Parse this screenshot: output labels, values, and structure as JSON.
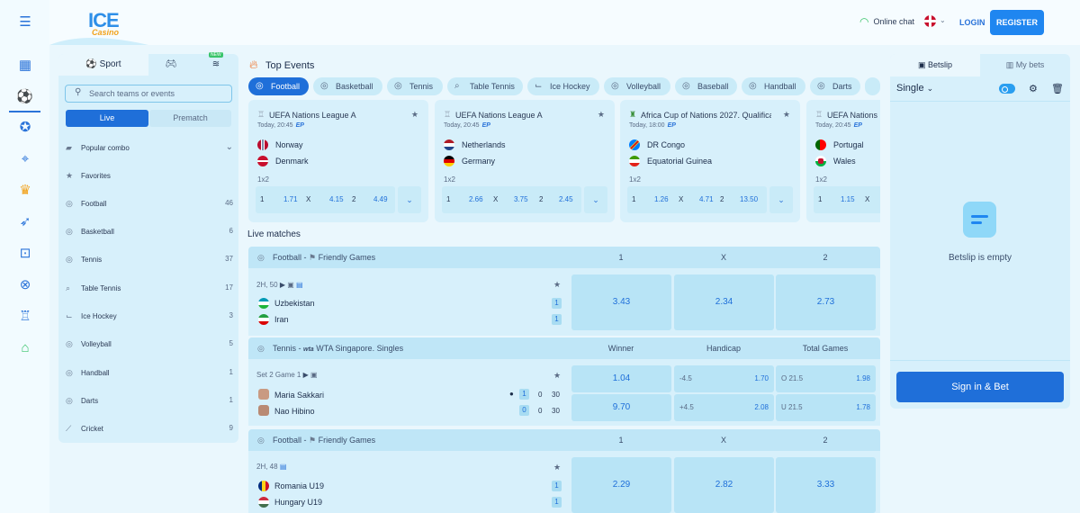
{
  "header": {
    "logo_text": "ICE",
    "logo_sub": "Casino",
    "online_chat": "Online chat",
    "login": "LOGIN",
    "register": "REGISTER"
  },
  "sport_panel": {
    "tabs": [
      "Sport",
      "",
      "",
      ""
    ],
    "new_badge": "NEW",
    "search_placeholder": "Search teams or events",
    "live": "Live",
    "prematch": "Prematch",
    "items": [
      {
        "label": "Popular combo",
        "count": ""
      },
      {
        "label": "Favorites",
        "count": ""
      },
      {
        "label": "Football",
        "count": "46"
      },
      {
        "label": "Basketball",
        "count": "6"
      },
      {
        "label": "Tennis",
        "count": "37"
      },
      {
        "label": "Table Tennis",
        "count": "17"
      },
      {
        "label": "Ice Hockey",
        "count": "3"
      },
      {
        "label": "Volleyball",
        "count": "5"
      },
      {
        "label": "Handball",
        "count": "1"
      },
      {
        "label": "Darts",
        "count": "1"
      },
      {
        "label": "Cricket",
        "count": "9"
      }
    ]
  },
  "top_events": {
    "title": "Top Events",
    "chips": [
      "Football",
      "Basketball",
      "Tennis",
      "Table Tennis",
      "Ice Hockey",
      "Volleyball",
      "Baseball",
      "Handball",
      "Darts"
    ],
    "cards": [
      {
        "league": "UEFA Nations League A",
        "time": "Today, 20:45",
        "ep": "EP",
        "team1": "Norway",
        "team2": "Denmark",
        "market": "1x2",
        "o1": "1.71",
        "ox": "4.15",
        "o2": "4.49"
      },
      {
        "league": "UEFA Nations League A",
        "time": "Today, 20:45",
        "ep": "EP",
        "team1": "Netherlands",
        "team2": "Germany",
        "market": "1x2",
        "o1": "2.66",
        "ox": "3.75",
        "o2": "2.45"
      },
      {
        "league": "Africa Cup of Nations 2027. Qualifica",
        "time": "Today, 18:00",
        "ep": "EP",
        "team1": "DR Congo",
        "team2": "Equatorial Guinea",
        "market": "1x2",
        "o1": "1.26",
        "ox": "4.71",
        "o2": "13.50"
      },
      {
        "league": "UEFA Nations",
        "time": "Today, 20:45",
        "ep": "EP",
        "team1": "Portugal",
        "team2": "Wales",
        "market": "1x2",
        "o1": "1.15",
        "ox": "",
        "o2": ""
      }
    ],
    "labels": {
      "one": "1",
      "x": "X",
      "two": "2"
    }
  },
  "live": {
    "title": "Live matches",
    "groups": [
      {
        "sport": "Football",
        "league": "Friendly Games",
        "cols": [
          "1",
          "X",
          "2"
        ]
      },
      {
        "sport": "Tennis",
        "league": "WTA Singapore. Singles",
        "cols": [
          "Winner",
          "Handicap",
          "Total Games"
        ]
      },
      {
        "sport": "Football",
        "league": "Friendly Games",
        "cols": [
          "1",
          "X",
          "2"
        ]
      }
    ],
    "m1": {
      "info": "2H, 50",
      "team1": "Uzbekistan",
      "team2": "Iran",
      "s1": "1",
      "s2": "1",
      "o1": "3.43",
      "ox": "2.34",
      "o2": "2.73"
    },
    "m2": {
      "info": "Set 2 Game 1",
      "team1": "Maria Sakkari",
      "team2": "Nao Hibino",
      "a1": "1",
      "a2": "0",
      "a3": "30",
      "b1": "0",
      "b2": "0",
      "b3": "30",
      "w1": "1.04",
      "w2": "9.70",
      "h1l": "-4.5",
      "h1": "1.70",
      "h2l": "+4.5",
      "h2": "2.08",
      "t1l": "O 21.5",
      "t1": "1.98",
      "t2l": "U 21.5",
      "t2": "1.78"
    },
    "m3": {
      "info": "2H, 48",
      "team1": "Romania U19",
      "team2": "Hungary U19",
      "s1": "1",
      "s2": "1",
      "o1": "2.29",
      "ox": "2.82",
      "o2": "3.33"
    }
  },
  "betslip": {
    "tab1": "Betslip",
    "tab2": "My bets",
    "mode": "Single",
    "empty": "Betslip is empty",
    "sign": "Sign in & Bet"
  }
}
